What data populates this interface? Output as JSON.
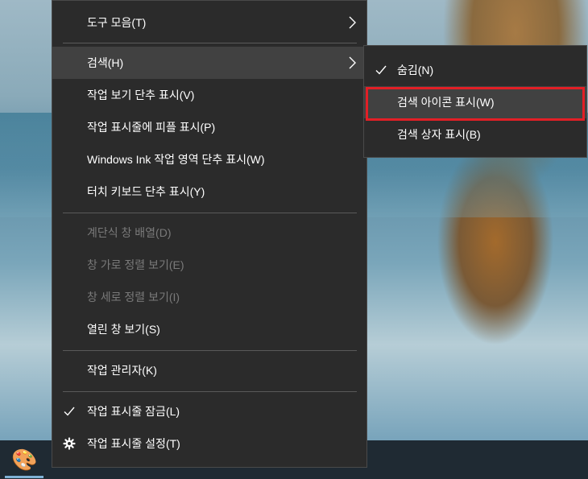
{
  "context_menu": {
    "items": [
      {
        "label": "도구 모음(T)"
      },
      {
        "label": "검색(H)"
      },
      {
        "label": "작업 보기 단추 표시(V)"
      },
      {
        "label": "작업 표시줄에 피플 표시(P)"
      },
      {
        "label": "Windows Ink 작업 영역 단추 표시(W)"
      },
      {
        "label": "터치 키보드 단추 표시(Y)"
      },
      {
        "label": "계단식 창 배열(D)"
      },
      {
        "label": "창 가로 정렬 보기(E)"
      },
      {
        "label": "창 세로 정렬 보기(I)"
      },
      {
        "label": "열린 창 보기(S)"
      },
      {
        "label": "작업 관리자(K)"
      },
      {
        "label": "작업 표시줄 잠금(L)"
      },
      {
        "label": "작업 표시줄 설정(T)"
      }
    ]
  },
  "search_submenu": {
    "items": [
      {
        "label": "숨김(N)"
      },
      {
        "label": "검색 아이콘 표시(W)"
      },
      {
        "label": "검색 상자 표시(B)"
      }
    ]
  },
  "colors": {
    "menu_bg": "#2b2b2b",
    "hover_bg": "#414141",
    "disabled_text": "#7a7a7a",
    "highlight_border": "#e21f26"
  },
  "icons": {
    "submenu_arrow": "chevron-right-icon",
    "check": "checkmark-icon",
    "settings": "gear-icon",
    "taskbar_app": "paint-palette-icon"
  }
}
